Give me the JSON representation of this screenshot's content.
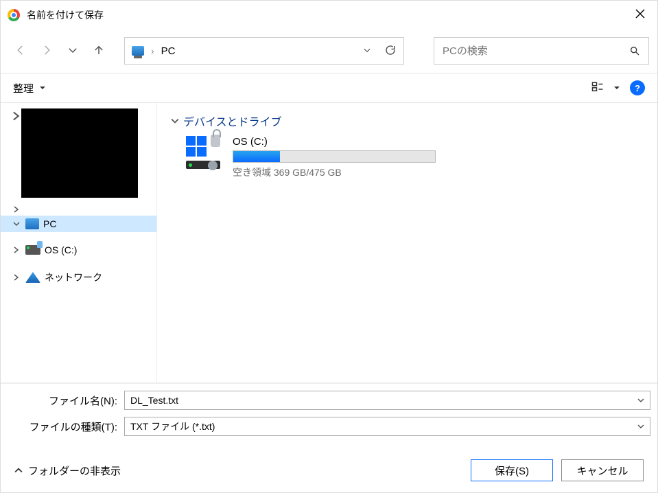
{
  "titlebar": {
    "title": "名前を付けて保存"
  },
  "nav": {
    "location_prefix": "›",
    "location": "PC",
    "search_placeholder": "PCの検索"
  },
  "toolbar": {
    "organize": "整理"
  },
  "sidebar": {
    "pc": "PC",
    "os_c": "OS (C:)",
    "network": "ネットワーク"
  },
  "main": {
    "group_label": "デバイスとドライブ",
    "drive": {
      "name": "OS (C:)",
      "free_label": "空き領域 369 GB/475 GB",
      "fill_percent": 23
    }
  },
  "form": {
    "filename_label": "ファイル名(N):",
    "filename_value": "DL_Test.txt",
    "filetype_label": "ファイルの種類(T):",
    "filetype_value": "TXT ファイル (*.txt)"
  },
  "footer": {
    "hide_folders": "フォルダーの非表示",
    "save": "保存(S)",
    "cancel": "キャンセル"
  }
}
